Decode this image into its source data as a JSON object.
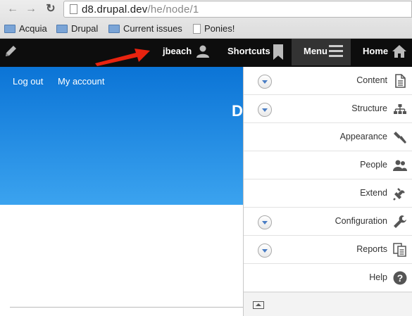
{
  "browser": {
    "url_host": "d8.drupal.dev",
    "url_path": "/he/node/1",
    "bookmarks": [
      "Acquia",
      "Drupal",
      "Current issues",
      "Ponies!"
    ]
  },
  "toolbar": {
    "user": "jbeach",
    "shortcuts": "Shortcuts",
    "menu": "Menu",
    "home": "Home"
  },
  "page": {
    "logout": "Log out",
    "my_account": "My account",
    "partial_title": "D"
  },
  "tray": {
    "items": [
      {
        "label": "Content",
        "icon": "content-icon",
        "expandable": true
      },
      {
        "label": "Structure",
        "icon": "structure-icon",
        "expandable": true
      },
      {
        "label": "Appearance",
        "icon": "appearance-icon",
        "expandable": false
      },
      {
        "label": "People",
        "icon": "people-icon",
        "expandable": false
      },
      {
        "label": "Extend",
        "icon": "extend-icon",
        "expandable": false
      },
      {
        "label": "Configuration",
        "icon": "configuration-icon",
        "expandable": true
      },
      {
        "label": "Reports",
        "icon": "reports-icon",
        "expandable": true
      },
      {
        "label": "Help",
        "icon": "help-icon",
        "expandable": false
      }
    ]
  },
  "colors": {
    "toolbar_bg": "#0d0d0d",
    "hero_top": "#0b74d6",
    "hero_bottom": "#3ba3ef",
    "arrow": "#e8230f"
  }
}
